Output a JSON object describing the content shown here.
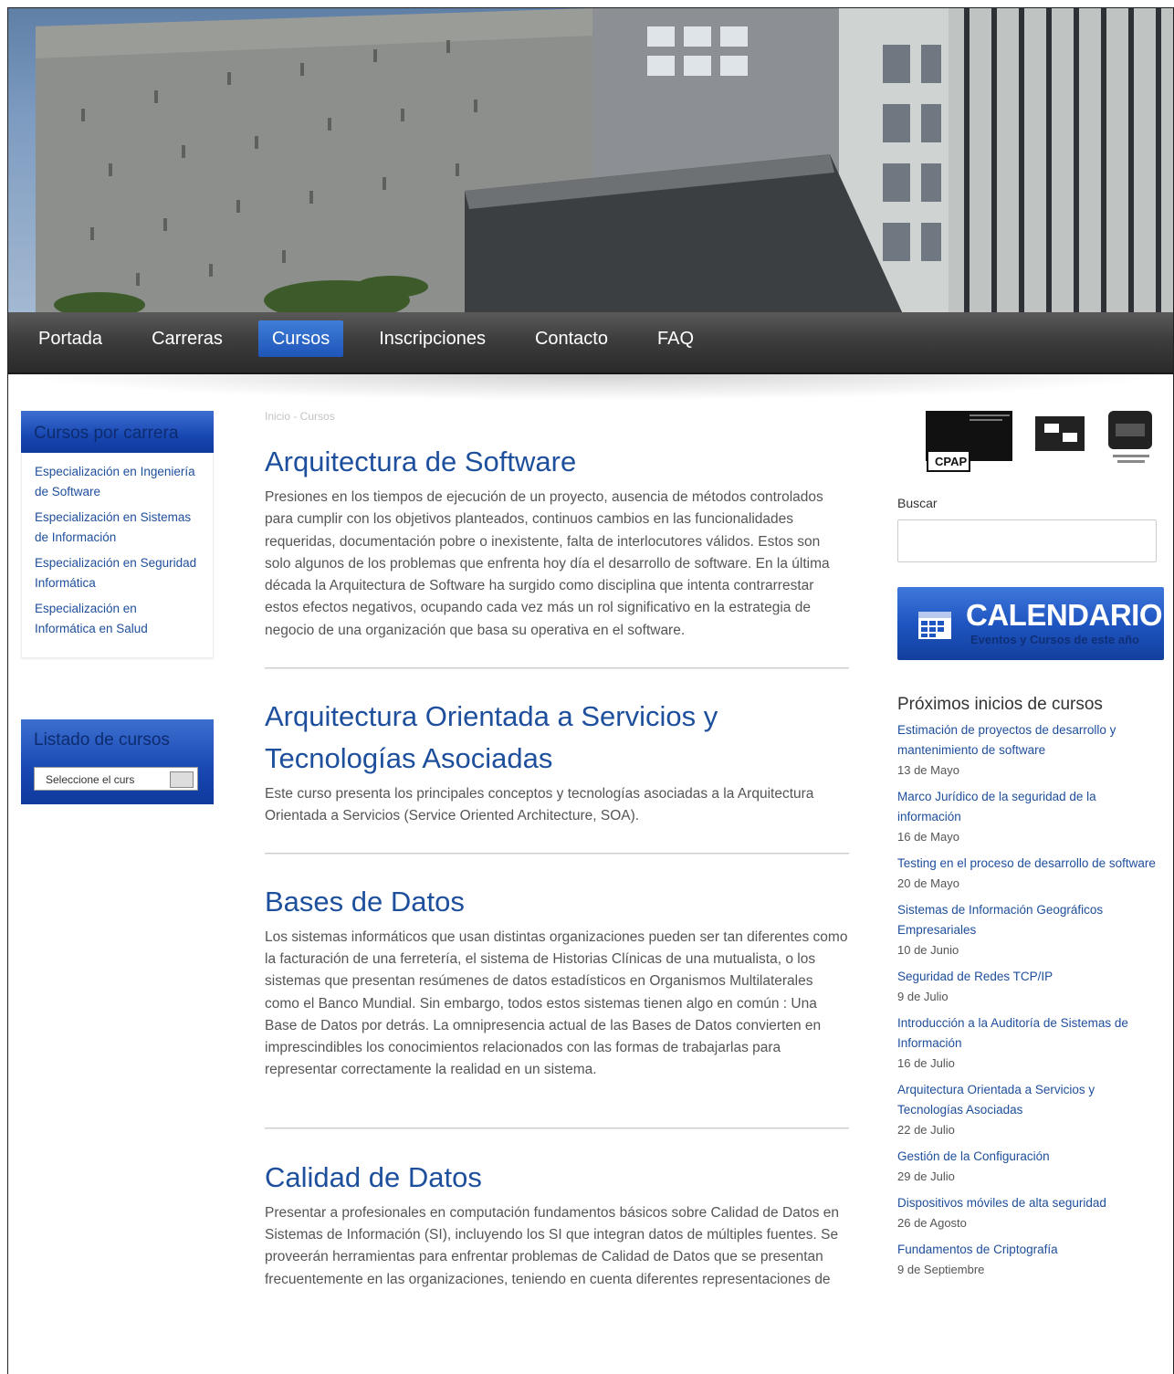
{
  "nav": {
    "items": [
      {
        "label": "Portada"
      },
      {
        "label": "Carreras"
      },
      {
        "label": "Cursos"
      },
      {
        "label": "Inscripciones"
      },
      {
        "label": "Contacto"
      },
      {
        "label": "FAQ"
      }
    ],
    "active": "Cursos"
  },
  "sidebar": {
    "cursos_por_carrera": {
      "title": "Cursos por carrera",
      "links": [
        {
          "label": "Especialización en Ingeniería de Software"
        },
        {
          "label": "Especialización en Sistemas de Información"
        },
        {
          "label": "Especialización en Seguridad Informática"
        },
        {
          "label": "Especialización en Informática en Salud"
        }
      ]
    },
    "listado": {
      "title": "Listado de cursos",
      "select_value": "Seleccione el curs"
    }
  },
  "breadcrumb": "Inicio - Cursos",
  "courses": [
    {
      "title": "Arquitectura de Software",
      "desc": "Presiones en los tiempos de ejecución de un proyecto, ausencia de métodos controlados para cumplir con los objetivos planteados, continuos cambios en las funcionalidades requeridas, documentación pobre o inexistente, falta de interlocutores válidos. Estos son solo algunos de los problemas que enfrenta hoy día el desarrollo de software. En la última década la Arquitectura de Software ha surgido como disciplina que intenta contrarrestar estos efectos negativos, ocupando cada vez más un rol significativo en la estrategia de negocio de una organización que basa su operativa en el software."
    },
    {
      "title": "Arquitectura Orientada a Servicios y Tecnologías Asociadas",
      "desc": "Este curso presenta los principales conceptos y tecnologías asociadas a la Arquitectura Orientada a Servicios (Service Oriented Architecture, SOA)."
    },
    {
      "title": "Bases de Datos",
      "desc": "Los sistemas informáticos que usan distintas organizaciones pueden ser tan diferentes como la facturación de una ferretería, el sistema de Historias Clínicas de una mutualista, o los sistemas que presentan resúmenes de datos estadísticos en Organismos Multilaterales como el Banco Mundial. Sin embargo, todos estos sistemas tienen algo en común : Una Base de Datos por detrás. La omnipresencia actual de las Bases de Datos convierten en imprescindibles los conocimientos relacionados con las formas de trabajarlas para representar correctamente la realidad en un sistema."
    },
    {
      "title": "Calidad de Datos",
      "desc": "Presentar a profesionales en computación fundamentos básicos sobre Calidad de Datos en Sistemas de Información (SI), incluyendo los SI que integran datos de múltiples fuentes. Se proveerán herramientas para enfrentar problemas de Calidad de Datos que se presentan frecuentemente en las organizaciones, teniendo en cuenta diferentes representaciones de"
    }
  ],
  "right": {
    "logos": [
      {
        "text": "CPAP"
      }
    ],
    "search_label": "Buscar",
    "calendar": {
      "title": "CALENDARIO",
      "subtitle": "Eventos y Cursos de este año"
    },
    "proximos": {
      "title": "Próximos inicios de cursos",
      "items": [
        {
          "name": "Estimación de proyectos de desarrollo y mantenimiento de software",
          "date": "13 de Mayo"
        },
        {
          "name": "Marco Jurídico de la seguridad de la información",
          "date": "16 de Mayo"
        },
        {
          "name": "Testing en el proceso de desarrollo de software",
          "date": "20 de Mayo"
        },
        {
          "name": "Sistemas de Información Geográficos Empresariales",
          "date": "10 de Junio"
        },
        {
          "name": "Seguridad de Redes TCP/IP",
          "date": "9 de Julio"
        },
        {
          "name": "Introducción a la Auditoría de Sistemas de Información",
          "date": "16 de Julio"
        },
        {
          "name": "Arquitectura Orientada a Servicios y Tecnologías Asociadas",
          "date": "22 de Julio"
        },
        {
          "name": "Gestión de la Configuración",
          "date": "29 de Julio"
        },
        {
          "name": "Dispositivos móviles de alta seguridad",
          "date": "26 de Agosto"
        },
        {
          "name": "Fundamentos de Criptografía",
          "date": "9 de Septiembre"
        }
      ]
    }
  }
}
